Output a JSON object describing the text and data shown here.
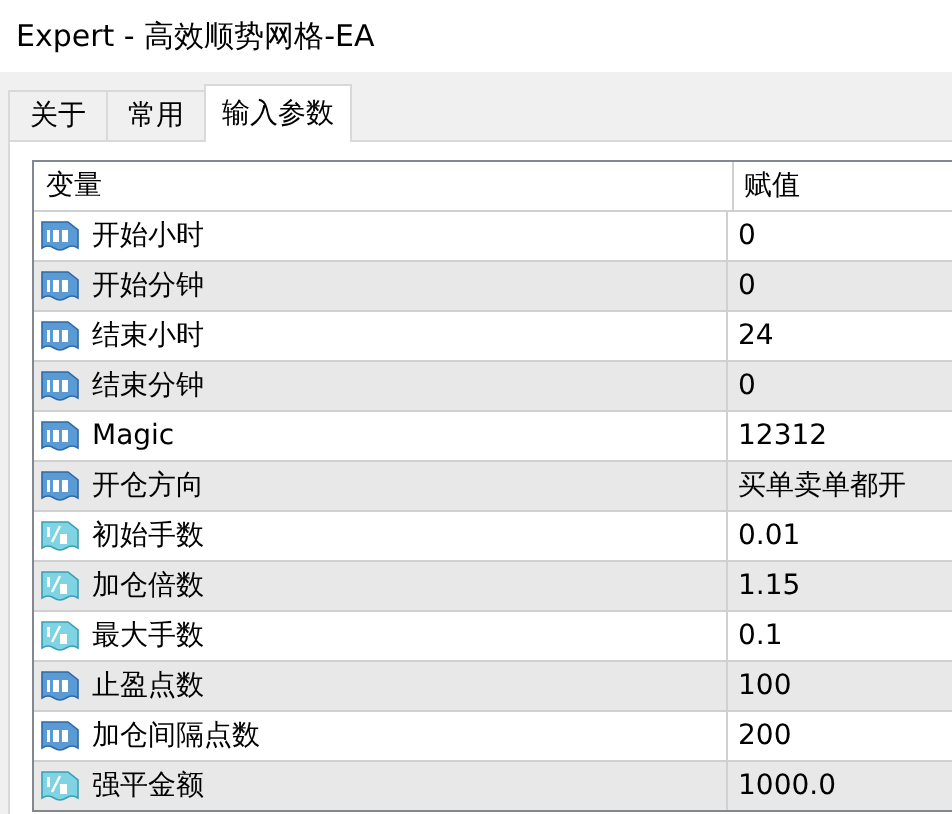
{
  "window": {
    "title": "Expert - 高效顺势网格-EA"
  },
  "tabs": [
    {
      "label": "关于",
      "selected": false
    },
    {
      "label": "常用",
      "selected": false
    },
    {
      "label": "输入参数",
      "selected": true
    }
  ],
  "table": {
    "columns": [
      "变量",
      "赋值"
    ],
    "rows": [
      {
        "kind": "int",
        "name": "开始小时",
        "value": "0"
      },
      {
        "kind": "int",
        "name": "开始分钟",
        "value": "0"
      },
      {
        "kind": "int",
        "name": "结束小时",
        "value": "24"
      },
      {
        "kind": "int",
        "name": "结束分钟",
        "value": "0"
      },
      {
        "kind": "int",
        "name": "Magic",
        "value": "12312"
      },
      {
        "kind": "int",
        "name": "开仓方向",
        "value": "买单卖单都开"
      },
      {
        "kind": "double",
        "name": "初始手数",
        "value": "0.01"
      },
      {
        "kind": "double",
        "name": "加仓倍数",
        "value": "1.15"
      },
      {
        "kind": "double",
        "name": "最大手数",
        "value": "0.1"
      },
      {
        "kind": "int",
        "name": "止盈点数",
        "value": "100"
      },
      {
        "kind": "int",
        "name": "加仓间隔点数",
        "value": "200"
      },
      {
        "kind": "double",
        "name": "强平金额",
        "value": "1000.0"
      }
    ]
  }
}
